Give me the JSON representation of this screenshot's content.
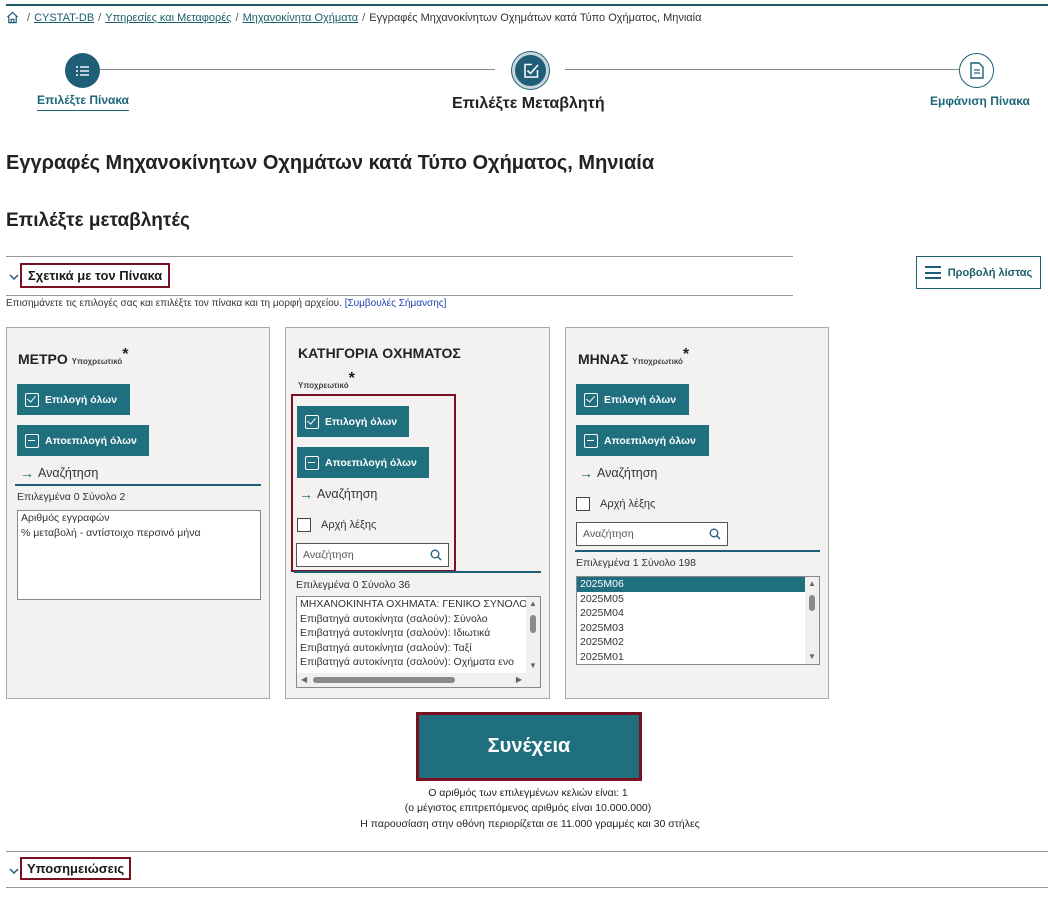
{
  "breadcrumb": {
    "items": [
      "CYSTAT-DB",
      "Υπηρεσίες και Μεταφορές",
      "Μηχανοκίνητα Οχήματα"
    ],
    "current": "Εγγραφές Μηχανοκίνητων Οχημάτων κατά Τύπο Οχήματος, Μηνιαία"
  },
  "steps": {
    "step1": "Επιλέξτε Πίνακα",
    "step2": "Επιλέξτε Μεταβλητή",
    "step3": "Εμφάνιση Πίνακα"
  },
  "page_title": "Εγγραφές Μηχανοκίνητων Οχημάτων κατά Τύπο Οχήματος, Μηνιαία",
  "section_title": "Επιλέξτε μεταβλητές",
  "about": {
    "label": "Σχετικά με τον Πίνακα",
    "hint": "Επισημάνετε τις επιλογές σας και επιλέξτε τον πίνακα και τη μορφή αρχείου.",
    "hint_link": "[Συμβουλές Σήμανσης]"
  },
  "list_view_button": "Προβολή λίστας",
  "common": {
    "required": "Υποχρεωτικό",
    "star": "*",
    "select_all": "Επιλογή όλων",
    "deselect_all": "Αποεπιλογή όλων",
    "search_link": "Αναζήτηση",
    "word_start": "Αρχή λέξης",
    "search_placeholder": "Αναζήτηση"
  },
  "panels": [
    {
      "title": "ΜΕΤΡΟ",
      "counts": "Επιλεγμένα 0 Σύνολο 2",
      "items": [
        "Αριθμός εγγραφών",
        "% μεταβολή - αντίστοιχο περσινό μήνα"
      ]
    },
    {
      "title": "ΚΑΤΗΓΟΡΙΑ ΟΧΗΜΑΤΟΣ",
      "counts": "Επιλεγμένα 0 Σύνολο 36",
      "items": [
        "ΜΗΧΑΝΟΚΙΝΗΤΑ ΟΧΗΜΑΤΑ: ΓΕΝΙΚΟ ΣΥΝΟΛΟ",
        "Επιβατηγά αυτοκίνητα (σαλούν): Σύνολο",
        "Επιβατηγά αυτοκίνητα (σαλούν): Ιδιωτικά",
        "Επιβατηγά αυτοκίνητα (σαλούν): Ταξί",
        "Επιβατηγά αυτοκίνητα (σαλούν): Οχήματα ενο"
      ]
    },
    {
      "title": "ΜΗΝΑΣ",
      "counts": "Επιλεγμένα 1 Σύνολο 198",
      "items": [
        "2025M06",
        "2025M05",
        "2025M04",
        "2025M03",
        "2025M02",
        "2025M01"
      ]
    }
  ],
  "continue_label": "Συνέχεια",
  "info": {
    "line1": "Ο αριθμός των επιλεγμένων κελιών είναι:   1",
    "line2": "(ο μέγιστος επιτρεπόμενος αριθμός είναι 10.000.000)",
    "line3": "Η παρουσίαση στην οθόνη περιορίζεται σε 11.000 γραμμές και 30 στήλες"
  },
  "footnotes_label": "Υποσημειώσεις",
  "colors": {
    "primary": "#1f6f7f",
    "highlight_frame": "#7a1020",
    "panel_bg": "#f3f2f1"
  }
}
